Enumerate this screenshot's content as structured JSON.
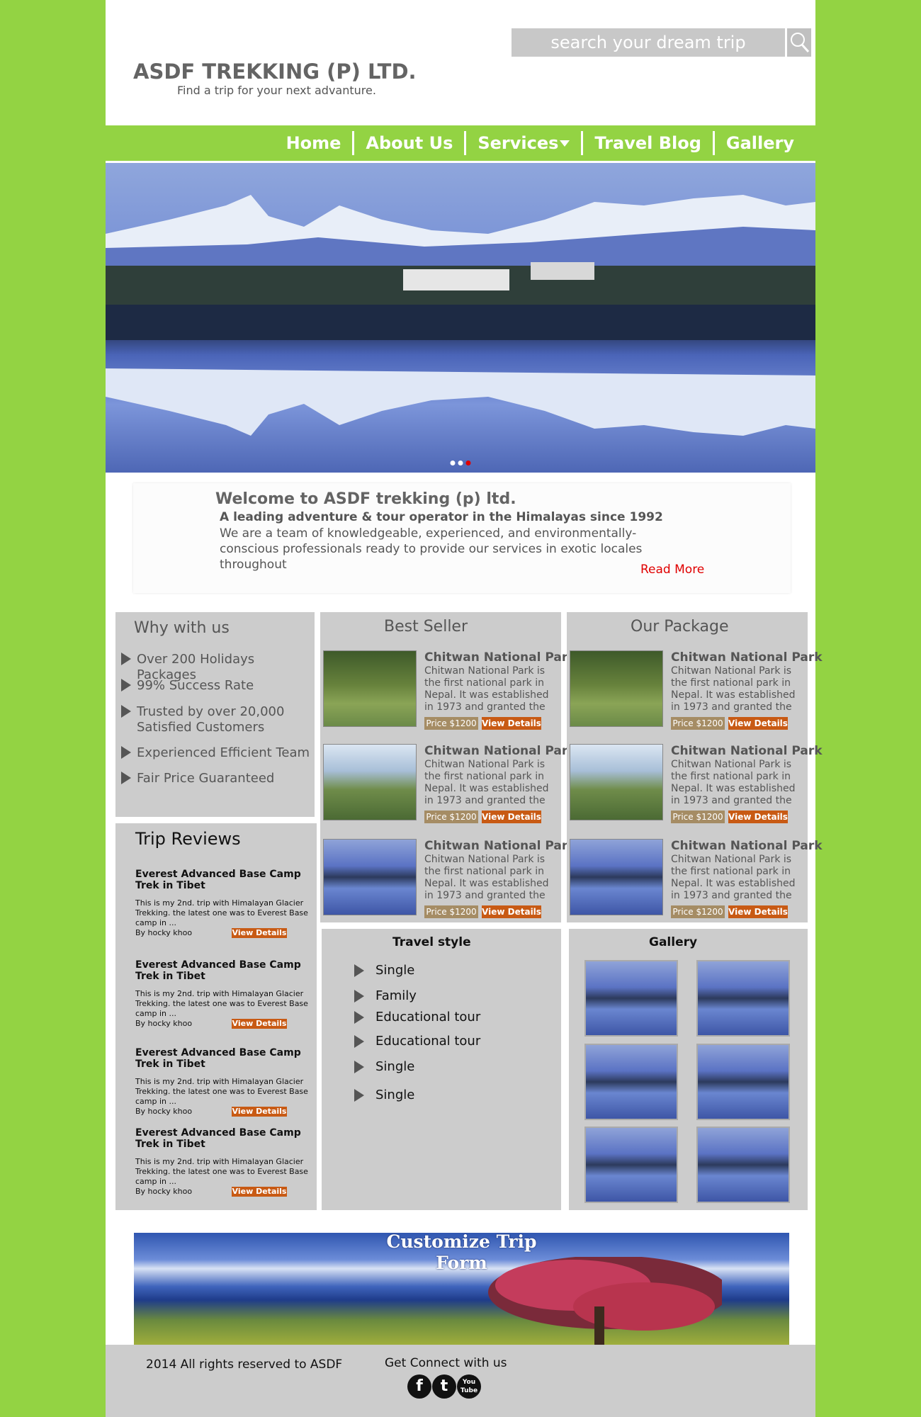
{
  "header": {
    "search_placeholder": "search your dream trip",
    "brand": "ASDF TREKKING (P) LTD.",
    "tagline": "Find a trip for your next advanture."
  },
  "nav": {
    "items": [
      "Home",
      "About Us",
      "Services",
      "Travel Blog",
      "Gallery"
    ]
  },
  "hero": {
    "slides": 3,
    "active_slide": 3
  },
  "welcome": {
    "title": "Welcome to ASDF trekking (p) ltd.",
    "subtitle": "A leading adventure & tour operator in the Himalayas since 1992",
    "body": "We are a team of knowledgeable, experienced, and environmentally-conscious professionals ready to provide our services in exotic locales throughout",
    "read_more": "Read More"
  },
  "why": {
    "title": "Why with us",
    "items": [
      "Over 200 Holidays Packages",
      "99% Success Rate",
      "Trusted by over 20,000\nSatisfied Customers",
      "Experienced Efficient Team",
      "Fair Price Guaranteed"
    ]
  },
  "best_seller": {
    "title": "Best Seller",
    "items": [
      {
        "title": "Chitwan National Park",
        "desc": "Chitwan National Park is the first national park in Nepal. It was established in 1973 and granted the",
        "price": "Price $1200",
        "view": "View Details"
      },
      {
        "title": "Chitwan National Park",
        "desc": "Chitwan National Park is the first national park in Nepal. It was established in 1973 and granted the",
        "price": "Price $1200",
        "view": "View Details"
      },
      {
        "title": "Chitwan National Park",
        "desc": "Chitwan National Park is the first national park in Nepal. It was established in 1973 and granted the",
        "price": "Price $1200",
        "view": "View Details"
      }
    ]
  },
  "our_package": {
    "title": "Our Package",
    "items": [
      {
        "title": "Chitwan National Park",
        "desc": "Chitwan National Park is the first national park in Nepal. It was established in 1973 and granted the",
        "price": "Price $1200",
        "view": "View Details"
      },
      {
        "title": "Chitwan National Park",
        "desc": "Chitwan National Park is the first national park in Nepal. It was established in 1973 and granted the",
        "price": "Price $1200",
        "view": "View Details"
      },
      {
        "title": "Chitwan National Park",
        "desc": "Chitwan National Park is the first national park in Nepal. It was established in 1973 and granted the",
        "price": "Price $1200",
        "view": "View Details"
      }
    ]
  },
  "reviews": {
    "title": "Trip Reviews",
    "items": [
      {
        "title": "Everest Advanced Base Camp Trek in Tibet",
        "body": "This is my 2nd. trip with Himalayan Glacier Trekking. the latest one was to Everest Base camp in ...",
        "by": "By hocky khoo",
        "view": "View Details"
      },
      {
        "title": "Everest Advanced Base Camp Trek in Tibet",
        "body": "This is my 2nd. trip with Himalayan Glacier Trekking. the latest one was to Everest Base camp in ...",
        "by": "By hocky khoo",
        "view": "View Details"
      },
      {
        "title": "Everest Advanced Base Camp Trek in Tibet",
        "body": "This is my 2nd. trip with Himalayan Glacier Trekking. the latest one was to Everest Base camp in ...",
        "by": "By hocky khoo",
        "view": "View Details"
      },
      {
        "title": "Everest Advanced Base Camp Trek in Tibet",
        "body": "This is my 2nd. trip with Himalayan Glacier Trekking. the latest one was to Everest Base camp in ...",
        "by": "By hocky khoo",
        "view": "View Details"
      }
    ]
  },
  "travel_style": {
    "title": "Travel style",
    "items": [
      "Single",
      "Family",
      "Educational tour",
      "Educational tour",
      "Single",
      "Single"
    ]
  },
  "gallery": {
    "title": "Gallery"
  },
  "banner": {
    "title": "Customize Trip\nForm"
  },
  "footer": {
    "copyright": "2014 All rights reserved to ASDF",
    "connect": "Get Connect with us",
    "social": [
      "facebook-icon",
      "twitter-icon",
      "youtube-icon"
    ]
  },
  "colors": {
    "green": "#93d343",
    "panel": "#cccccc",
    "orange": "#c85a14",
    "red": "#e00000"
  }
}
